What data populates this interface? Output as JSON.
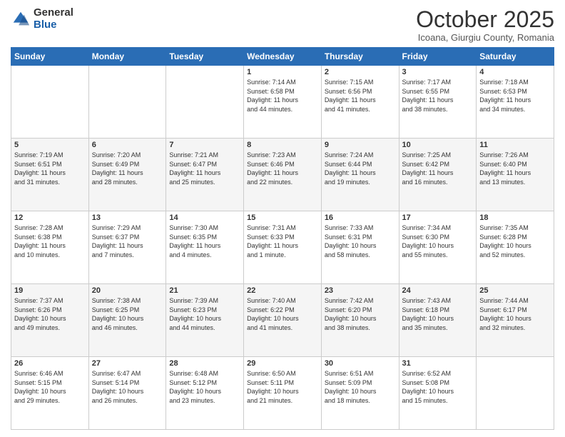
{
  "logo": {
    "general": "General",
    "blue": "Blue"
  },
  "header": {
    "month_title": "October 2025",
    "location": "Icoana, Giurgiu County, Romania"
  },
  "days_of_week": [
    "Sunday",
    "Monday",
    "Tuesday",
    "Wednesday",
    "Thursday",
    "Friday",
    "Saturday"
  ],
  "weeks": [
    [
      {
        "day": "",
        "info": ""
      },
      {
        "day": "",
        "info": ""
      },
      {
        "day": "",
        "info": ""
      },
      {
        "day": "1",
        "info": "Sunrise: 7:14 AM\nSunset: 6:58 PM\nDaylight: 11 hours\nand 44 minutes."
      },
      {
        "day": "2",
        "info": "Sunrise: 7:15 AM\nSunset: 6:56 PM\nDaylight: 11 hours\nand 41 minutes."
      },
      {
        "day": "3",
        "info": "Sunrise: 7:17 AM\nSunset: 6:55 PM\nDaylight: 11 hours\nand 38 minutes."
      },
      {
        "day": "4",
        "info": "Sunrise: 7:18 AM\nSunset: 6:53 PM\nDaylight: 11 hours\nand 34 minutes."
      }
    ],
    [
      {
        "day": "5",
        "info": "Sunrise: 7:19 AM\nSunset: 6:51 PM\nDaylight: 11 hours\nand 31 minutes."
      },
      {
        "day": "6",
        "info": "Sunrise: 7:20 AM\nSunset: 6:49 PM\nDaylight: 11 hours\nand 28 minutes."
      },
      {
        "day": "7",
        "info": "Sunrise: 7:21 AM\nSunset: 6:47 PM\nDaylight: 11 hours\nand 25 minutes."
      },
      {
        "day": "8",
        "info": "Sunrise: 7:23 AM\nSunset: 6:46 PM\nDaylight: 11 hours\nand 22 minutes."
      },
      {
        "day": "9",
        "info": "Sunrise: 7:24 AM\nSunset: 6:44 PM\nDaylight: 11 hours\nand 19 minutes."
      },
      {
        "day": "10",
        "info": "Sunrise: 7:25 AM\nSunset: 6:42 PM\nDaylight: 11 hours\nand 16 minutes."
      },
      {
        "day": "11",
        "info": "Sunrise: 7:26 AM\nSunset: 6:40 PM\nDaylight: 11 hours\nand 13 minutes."
      }
    ],
    [
      {
        "day": "12",
        "info": "Sunrise: 7:28 AM\nSunset: 6:38 PM\nDaylight: 11 hours\nand 10 minutes."
      },
      {
        "day": "13",
        "info": "Sunrise: 7:29 AM\nSunset: 6:37 PM\nDaylight: 11 hours\nand 7 minutes."
      },
      {
        "day": "14",
        "info": "Sunrise: 7:30 AM\nSunset: 6:35 PM\nDaylight: 11 hours\nand 4 minutes."
      },
      {
        "day": "15",
        "info": "Sunrise: 7:31 AM\nSunset: 6:33 PM\nDaylight: 11 hours\nand 1 minute."
      },
      {
        "day": "16",
        "info": "Sunrise: 7:33 AM\nSunset: 6:31 PM\nDaylight: 10 hours\nand 58 minutes."
      },
      {
        "day": "17",
        "info": "Sunrise: 7:34 AM\nSunset: 6:30 PM\nDaylight: 10 hours\nand 55 minutes."
      },
      {
        "day": "18",
        "info": "Sunrise: 7:35 AM\nSunset: 6:28 PM\nDaylight: 10 hours\nand 52 minutes."
      }
    ],
    [
      {
        "day": "19",
        "info": "Sunrise: 7:37 AM\nSunset: 6:26 PM\nDaylight: 10 hours\nand 49 minutes."
      },
      {
        "day": "20",
        "info": "Sunrise: 7:38 AM\nSunset: 6:25 PM\nDaylight: 10 hours\nand 46 minutes."
      },
      {
        "day": "21",
        "info": "Sunrise: 7:39 AM\nSunset: 6:23 PM\nDaylight: 10 hours\nand 44 minutes."
      },
      {
        "day": "22",
        "info": "Sunrise: 7:40 AM\nSunset: 6:22 PM\nDaylight: 10 hours\nand 41 minutes."
      },
      {
        "day": "23",
        "info": "Sunrise: 7:42 AM\nSunset: 6:20 PM\nDaylight: 10 hours\nand 38 minutes."
      },
      {
        "day": "24",
        "info": "Sunrise: 7:43 AM\nSunset: 6:18 PM\nDaylight: 10 hours\nand 35 minutes."
      },
      {
        "day": "25",
        "info": "Sunrise: 7:44 AM\nSunset: 6:17 PM\nDaylight: 10 hours\nand 32 minutes."
      }
    ],
    [
      {
        "day": "26",
        "info": "Sunrise: 6:46 AM\nSunset: 5:15 PM\nDaylight: 10 hours\nand 29 minutes."
      },
      {
        "day": "27",
        "info": "Sunrise: 6:47 AM\nSunset: 5:14 PM\nDaylight: 10 hours\nand 26 minutes."
      },
      {
        "day": "28",
        "info": "Sunrise: 6:48 AM\nSunset: 5:12 PM\nDaylight: 10 hours\nand 23 minutes."
      },
      {
        "day": "29",
        "info": "Sunrise: 6:50 AM\nSunset: 5:11 PM\nDaylight: 10 hours\nand 21 minutes."
      },
      {
        "day": "30",
        "info": "Sunrise: 6:51 AM\nSunset: 5:09 PM\nDaylight: 10 hours\nand 18 minutes."
      },
      {
        "day": "31",
        "info": "Sunrise: 6:52 AM\nSunset: 5:08 PM\nDaylight: 10 hours\nand 15 minutes."
      },
      {
        "day": "",
        "info": ""
      }
    ]
  ]
}
